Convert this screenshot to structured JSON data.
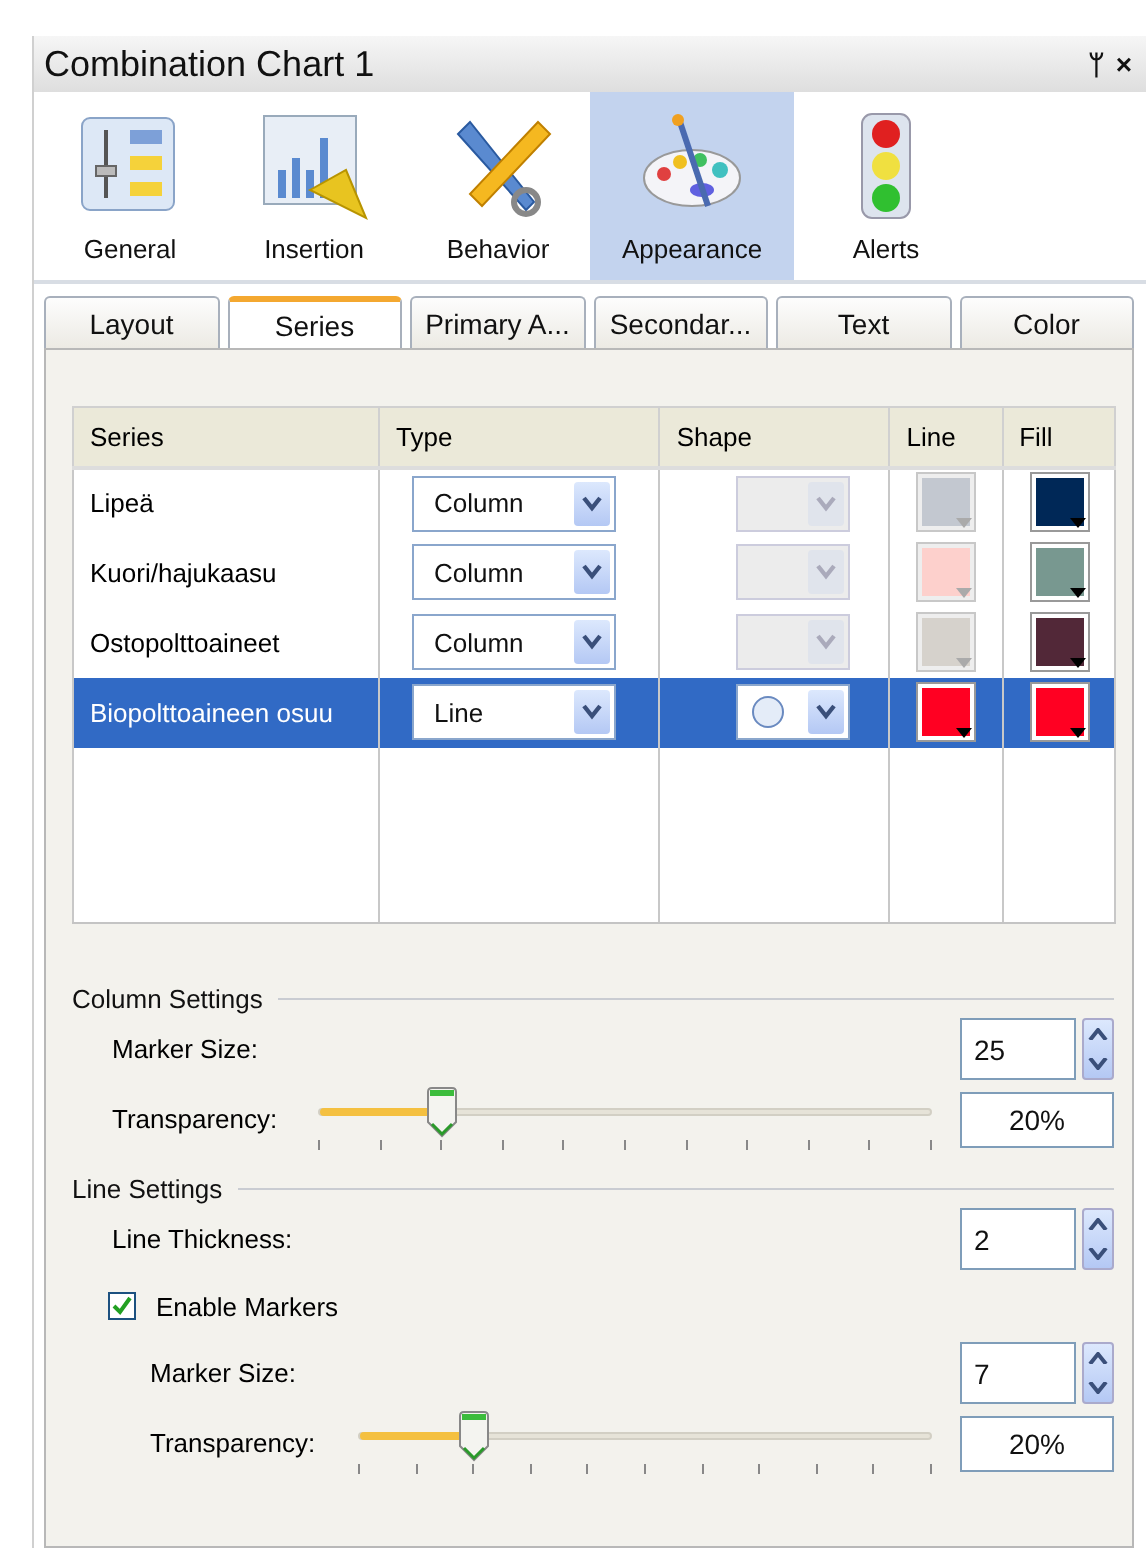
{
  "window": {
    "title": "Combination Chart 1",
    "buttons": [
      "ᛘ",
      "×"
    ]
  },
  "toolbar": [
    {
      "label": "General",
      "kind": "general",
      "selected": false
    },
    {
      "label": "Insertion",
      "kind": "insertion",
      "selected": false
    },
    {
      "label": "Behavior",
      "kind": "behavior",
      "selected": false
    },
    {
      "label": "Appearance",
      "kind": "appearance",
      "selected": true
    },
    {
      "label": "Alerts",
      "kind": "alerts",
      "selected": false
    }
  ],
  "tabs": [
    {
      "label": "Layout",
      "selected": false
    },
    {
      "label": "Series",
      "selected": true
    },
    {
      "label": "Primary A...",
      "selected": false
    },
    {
      "label": "Secondar...",
      "selected": false
    },
    {
      "label": "Text",
      "selected": false
    },
    {
      "label": "Color",
      "selected": false
    }
  ],
  "table": {
    "columns": [
      "Series",
      "Type",
      "Shape",
      "Line",
      "Fill"
    ],
    "rows": [
      {
        "series": "Lipeä",
        "type": "Column",
        "shape_disabled": true,
        "line": {
          "color": "#c3c8d0",
          "disabled": true
        },
        "fill": {
          "color": "#002857"
        },
        "selected": false
      },
      {
        "series": "Kuori/hajukaasu",
        "type": "Column",
        "shape_disabled": true,
        "line": {
          "color": "#fdd0cc",
          "disabled": true
        },
        "fill": {
          "color": "#789890"
        },
        "selected": false
      },
      {
        "series": "Ostopolttoaineet",
        "type": "Column",
        "shape_disabled": true,
        "line": {
          "color": "#d6d2cc",
          "disabled": true
        },
        "fill": {
          "color": "#522838"
        },
        "selected": false
      },
      {
        "series": "Biopolttoaineen osuu",
        "type": "Line",
        "shape_disabled": false,
        "line": {
          "color": "#ff0022",
          "disabled": false
        },
        "fill": {
          "color": "#ff0022"
        },
        "selected": true
      }
    ]
  },
  "column_settings": {
    "title": "Column Settings",
    "marker_size": {
      "label": "Marker Size:",
      "value": "25"
    },
    "transparency": {
      "label": "Transparency:",
      "level": 0.2,
      "value": "20%"
    }
  },
  "line_settings": {
    "title": "Line Settings",
    "line_thickness": {
      "label": "Line Thickness:",
      "value": "2"
    },
    "enable_markers": {
      "label": "Enable Markers",
      "checked": true
    },
    "marker_size": {
      "label": "Marker Size:",
      "value": "7"
    },
    "transparency": {
      "label": "Transparency:",
      "level": 0.2,
      "value": "20%"
    }
  }
}
